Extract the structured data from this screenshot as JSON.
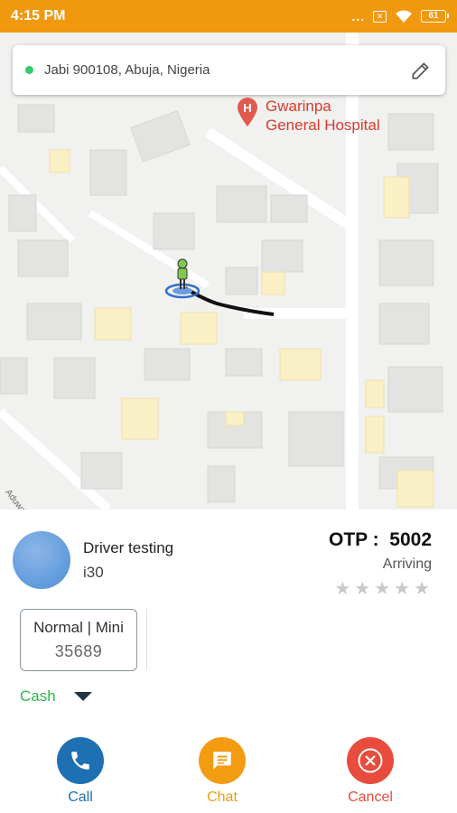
{
  "status_bar": {
    "time": "4:15 PM",
    "dots": "...",
    "sim_icon": "x-box-icon",
    "wifi_icon": "wifi-icon",
    "battery": "61"
  },
  "map": {
    "pickup_address": "Jabi 900108, Abuja, Nigeria",
    "poi_line1": "Gwarinpa",
    "poi_line2": "General Hospital",
    "street_label": "Aduwa Cl"
  },
  "driver": {
    "name": "Driver testing",
    "car_model": "i30",
    "otp_label": "OTP :",
    "otp_value": "5002",
    "status": "Arriving",
    "rating": 0,
    "rating_max": 5
  },
  "vehicle": {
    "type": "Normal | Mini",
    "number": "35689"
  },
  "payment": {
    "method": "Cash"
  },
  "actions": {
    "call": "Call",
    "chat": "Chat",
    "cancel": "Cancel"
  },
  "colors": {
    "status_bar": "#f0980e",
    "call": "#1f6fb3",
    "chat": "#f39c12",
    "cancel": "#e74c3c",
    "cash": "#2eb84f",
    "poi": "#d93a2f"
  }
}
